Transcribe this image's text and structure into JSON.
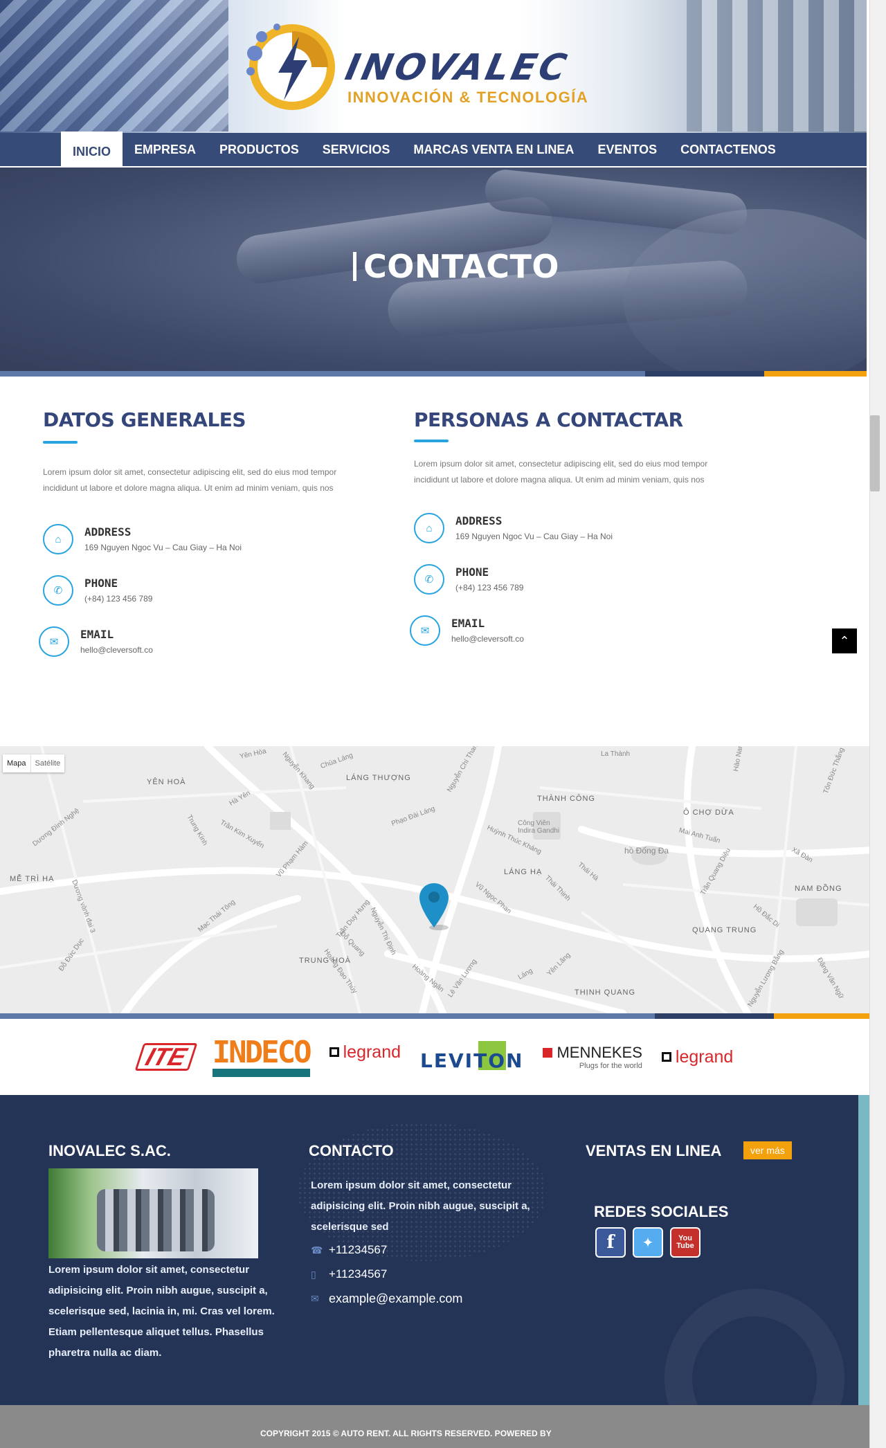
{
  "brand": {
    "name": "INOVALEC",
    "tagline": "INNOVACIÓN & TECNOLOGÍA"
  },
  "nav": {
    "items": [
      "INICIO",
      "EMPRESA",
      "PRODUCTOS",
      "SERVICIOS",
      "MARCAS VENTA EN LINEA",
      "EVENTOS",
      "CONTACTENOS"
    ],
    "active": "INICIO"
  },
  "hero": {
    "title": "CONTACTO"
  },
  "datos": {
    "title": "DATOS GENERALES",
    "intro": "Lorem ipsum dolor sit amet, consectetur adipiscing elit, sed do eius mod tempor incididunt ut labore et dolore magna aliqua. Ut enim ad minim veniam, quis nos",
    "address_label": "ADDRESS",
    "address": "169 Nguyen Ngoc Vu – Cau Giay – Ha Noi",
    "phone_label": "PHONE",
    "phone": "(+84) 123 456 789",
    "email_label": "EMAIL",
    "email": "hello@cleversoft.co"
  },
  "personas": {
    "title": "PERSONAS A CONTACTAR",
    "intro": "Lorem ipsum dolor sit amet, consectetur adipiscing elit, sed do eius mod tempor incididunt ut labore et dolore magna aliqua. Ut enim ad minim veniam, quis nos",
    "address_label": "ADDRESS",
    "address": "169 Nguyen Ngoc Vu – Cau Giay – Ha Noi",
    "phone_label": "PHONE",
    "phone": "(+84) 123 456 789",
    "email_label": "EMAIL",
    "email": "hello@cleversoft.co"
  },
  "map": {
    "toggle_map": "Mapa",
    "toggle_satellite": "Satélite",
    "districts": [
      "YÊN HOÀ",
      "LÁNG THƯỢNG",
      "THÀNH CÔNG",
      "Ô CHỢ DỪA",
      "MỄ TRÌ HẠ",
      "LÁNG HẠ",
      "NAM ĐỒNG",
      "QUANG TRUNG",
      "TRUNG HOÀ",
      "THỊNH QUANG"
    ],
    "streets": [
      "Yên Hòa",
      "Nguyễn Khang",
      "Chùa Láng",
      "Nguyễn Chí Thanh",
      "La Thành",
      "Hào Nam",
      "Tôn Đức Thắng",
      "Dương Đình Nghệ",
      "Trung Kính",
      "Trần Kim Xuyến",
      "Hà Yên",
      "Phạo Đài Láng",
      "Huỳnh Thúc Kháng",
      "Mai Anh Tuấn",
      "hồ Đống Đa",
      "Công Viên Indira Gandhi",
      "Vũ Phạm Hàm",
      "Trần Duy Hưng",
      "Thái Hà",
      "Vũ Ngọc Phan",
      "Láng",
      "Hoàng Đạo Thúy",
      "Lê Văn Lương",
      "Yên Lãng",
      "Thái Thịnh",
      "Đặng Văn Ngữ",
      "Xã Đàn",
      "Hồ Đắc Di",
      "Đỗ Quang",
      "Nguyễn Thị Định",
      "Dương vành đai 3",
      "Đỗ Đức Dục",
      "Mạc Thái Tông",
      "Hoàng Ngân",
      "Nguyễn Lương Bằng",
      "Trần Quang Diệu"
    ]
  },
  "brands": [
    "ITE",
    "INDECO",
    "legrand",
    "LEVITON",
    "MENNEKES",
    "legrand"
  ],
  "brand_sub": {
    "mennekes": "Plugs for the world"
  },
  "footer": {
    "company_title": "INOVALEC S.AC.",
    "company_text": "Lorem ipsum dolor sit amet, consectetur adipisicing elit. Proin nibh augue, suscipit a, scelerisque sed, lacinia in, mi. Cras vel lorem. Etiam pellentesque aliquet tellus. Phasellus pharetra nulla ac diam.",
    "contact_title": "CONTACTO",
    "contact_text": "Lorem ipsum dolor sit amet, consectetur adipisicing elit. Proin nibh augue, suscipit a, scelerisque sed",
    "phone1": "+11234567",
    "phone2": "+11234567",
    "email": "example@example.com",
    "ventas_title": "VENTAS EN LINEA",
    "ver_mas": "ver más",
    "redes_title": "REDES SOCIALES",
    "social": [
      "facebook",
      "twitter",
      "youtube"
    ]
  },
  "copyright": "COPYRIGHT 2015 © AUTO RENT. ALL RIGHTS RESERVED.  POWERED BY",
  "colors": {
    "primary": "#364b78",
    "accent": "#27a4e0",
    "orange": "#f3a10d",
    "footer": "#243457"
  }
}
